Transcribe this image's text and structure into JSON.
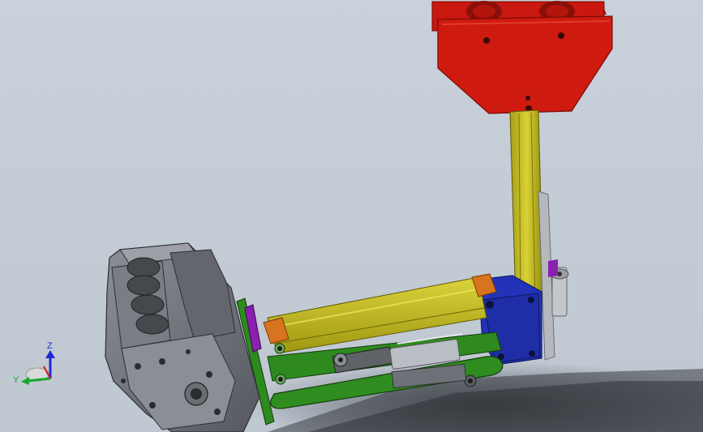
{
  "viewport": {
    "background_top": "#c9d1da",
    "background_bottom": "#bfc7d1"
  },
  "triad": {
    "z_label": "Z",
    "y_label": "Y",
    "z_color": "#1d2ad6",
    "y_color": "#18a82a",
    "x_color": "#d81e1e"
  },
  "model": {
    "parts": [
      {
        "name": "gantry-trolley",
        "color": "#c8180f"
      },
      {
        "name": "vertical-column",
        "color": "#c9c21e"
      },
      {
        "name": "horizontal-arm",
        "color": "#c9c21e"
      },
      {
        "name": "arm-joint-plate",
        "color": "#2333b8"
      },
      {
        "name": "lower-link",
        "color": "#2e8a1f"
      },
      {
        "name": "gripper-plate",
        "color": "#2e8a1f"
      },
      {
        "name": "end-caps",
        "color": "#d8731e"
      },
      {
        "name": "engine-block",
        "color": "#6b6e74"
      },
      {
        "name": "pneumatic-cylinder",
        "color": "#9aa0a8"
      },
      {
        "name": "pivot-pins",
        "color": "#8a1fb0"
      }
    ]
  }
}
